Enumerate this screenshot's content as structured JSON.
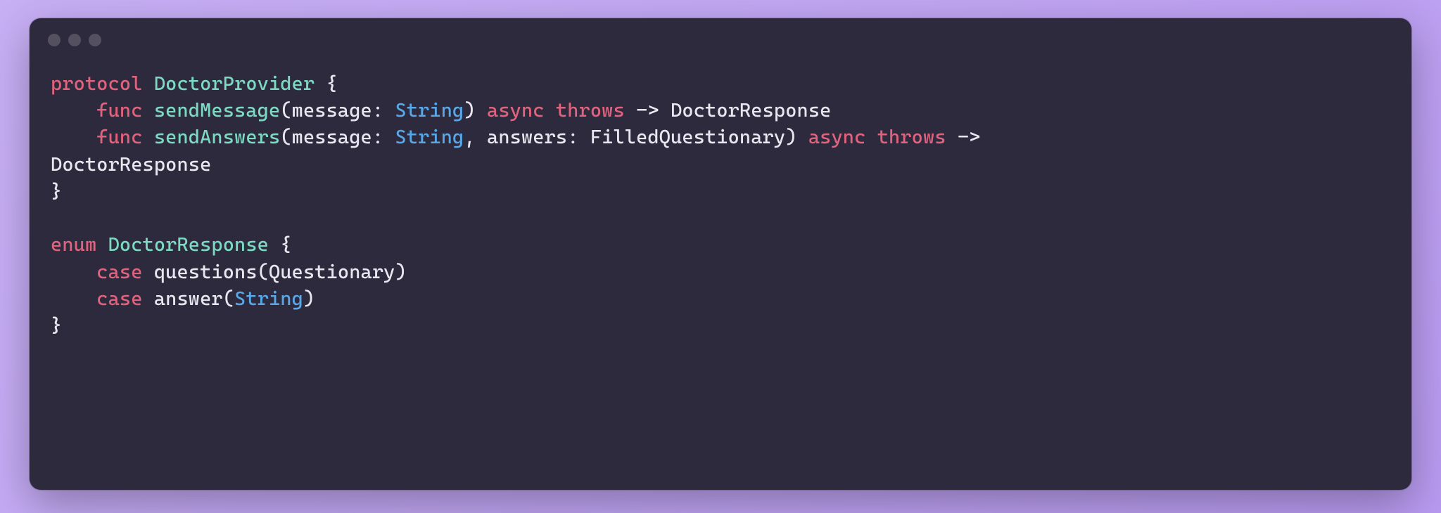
{
  "code": {
    "line1": {
      "kw_protocol": "protocol",
      "name": "DoctorProvider",
      "tail": " {"
    },
    "line2": {
      "indent": "    ",
      "kw_func": "func",
      "fn": "sendMessage",
      "open": "(",
      "p1_label": "message",
      "colon1": ": ",
      "p1_type": "String",
      "close": ") ",
      "kw_async": "async",
      "sp1": " ",
      "kw_throws": "throws",
      "arrow": " -> ",
      "ret": "DoctorResponse"
    },
    "line3": {
      "indent": "    ",
      "kw_func": "func",
      "fn": "sendAnswers",
      "open": "(",
      "p1_label": "message",
      "colon1": ": ",
      "p1_type": "String",
      "comma": ", ",
      "p2_label": "answers",
      "colon2": ": ",
      "p2_type": "FilledQuestionary",
      "close": ") ",
      "kw_async": "async",
      "sp1": " ",
      "kw_throws": "throws",
      "arrow": " -> "
    },
    "line4": {
      "ret": "DoctorResponse"
    },
    "line5": {
      "brace": "}"
    },
    "line6": {
      "blank": ""
    },
    "line7": {
      "kw_enum": "enum",
      "name": "DoctorResponse",
      "tail": " {"
    },
    "line8": {
      "indent": "    ",
      "kw_case": "case",
      "name": "questions",
      "open": "(",
      "type": "Questionary",
      "close": ")"
    },
    "line9": {
      "indent": "    ",
      "kw_case": "case",
      "name": "answer",
      "open": "(",
      "type": "String",
      "close": ")"
    },
    "line10": {
      "brace": "}"
    }
  }
}
